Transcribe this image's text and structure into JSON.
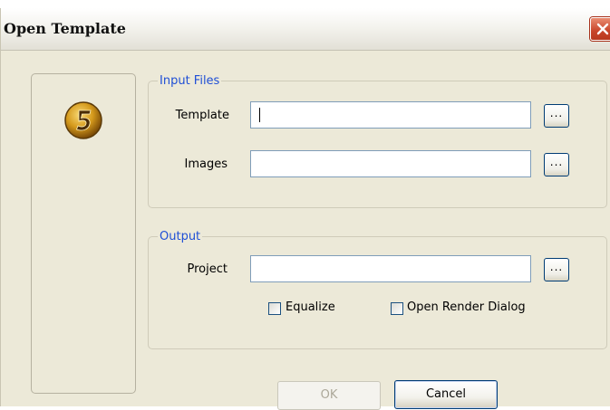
{
  "window": {
    "title": "Open Template"
  },
  "input_files": {
    "legend": "Input Files",
    "template": {
      "label": "Template",
      "value": ""
    },
    "images": {
      "label": "Images",
      "value": ""
    }
  },
  "output": {
    "legend": "Output",
    "project": {
      "label": "Project",
      "value": ""
    },
    "equalize": {
      "label": "Equalize",
      "checked": false
    },
    "open_render_dialog": {
      "label": "Open Render Dialog",
      "checked": false
    }
  },
  "browse_label": "...",
  "buttons": {
    "ok": "OK",
    "cancel": "Cancel",
    "ok_enabled": false
  },
  "icons": {
    "logo": "number-5-logo-icon",
    "close": "close-icon"
  },
  "colors": {
    "legend": "#1f4fd6",
    "window_bg": "#ECE9D8",
    "close": "#c8452a"
  }
}
